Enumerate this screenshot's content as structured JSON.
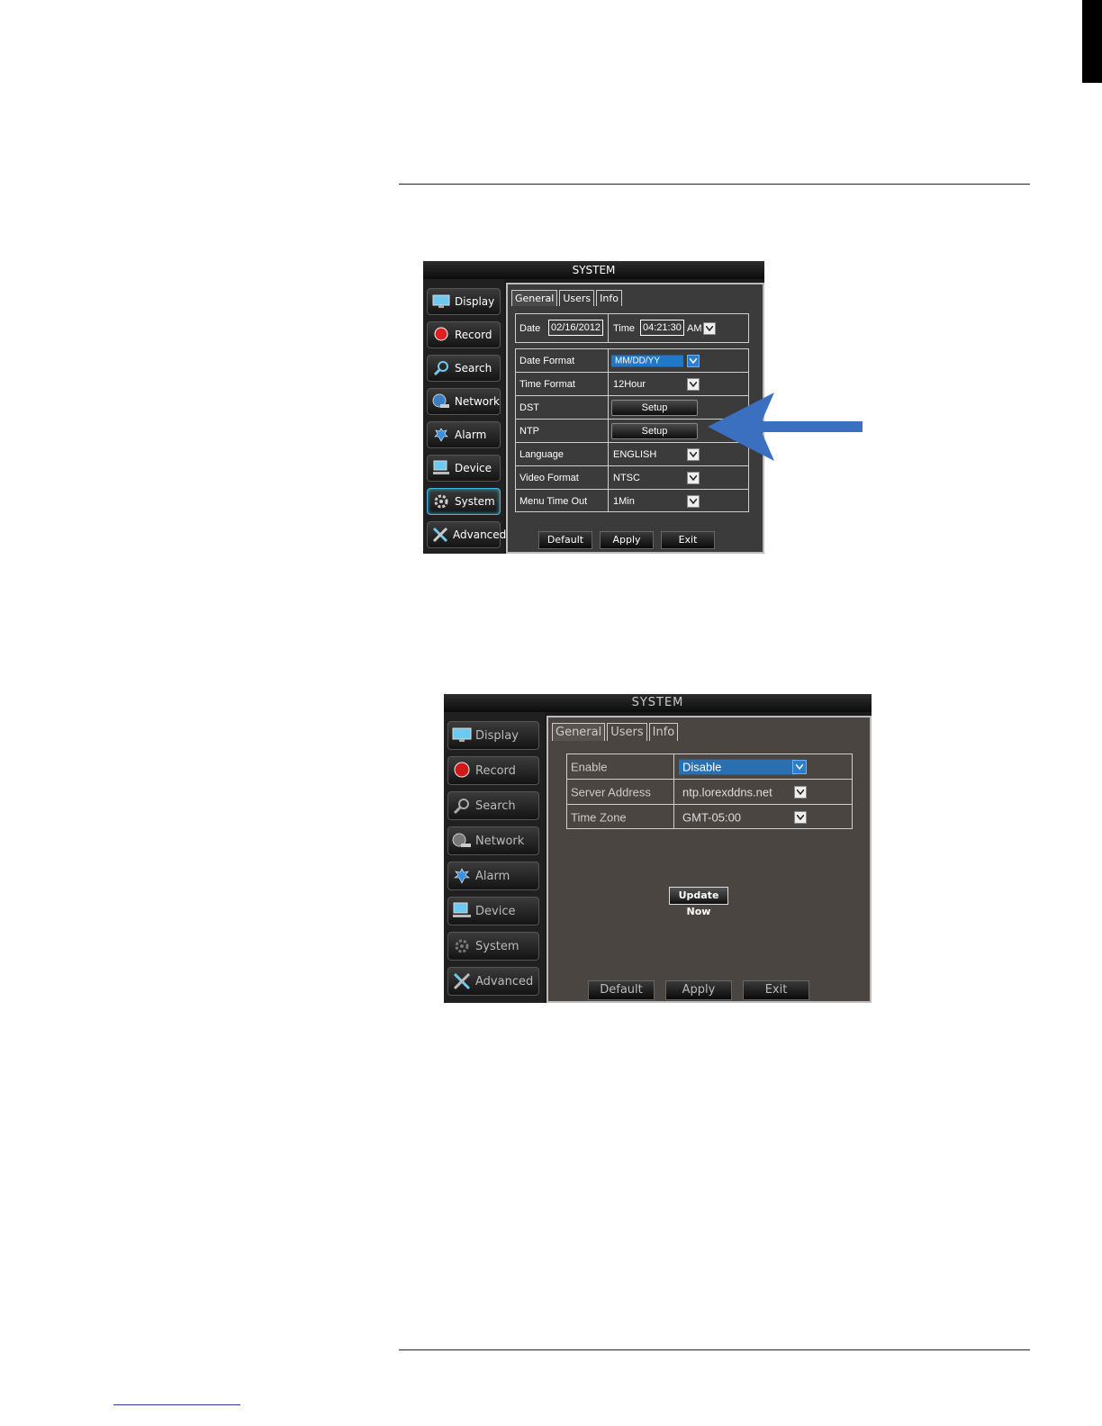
{
  "screenshot1": {
    "title": "SYSTEM",
    "sidebar": [
      "Display",
      "Record",
      "Search",
      "Network",
      "Alarm",
      "Device",
      "System",
      "Advanced"
    ],
    "tabs": [
      "General",
      "Users",
      "Info"
    ],
    "date_label": "Date",
    "date_value": "02/16/2012",
    "time_label": "Time",
    "time_value": "04:21:30",
    "ampm": "AM",
    "rows": [
      {
        "label": "Date Format",
        "value": "MM/DD/YY"
      },
      {
        "label": "Time Format",
        "value": "12Hour"
      },
      {
        "label": "DST",
        "value": "Setup"
      },
      {
        "label": "NTP",
        "value": "Setup"
      },
      {
        "label": "Language",
        "value": "ENGLISH"
      },
      {
        "label": "Video Format",
        "value": "NTSC"
      },
      {
        "label": "Menu Time Out",
        "value": "1Min"
      }
    ],
    "buttons": [
      "Default",
      "Apply",
      "Exit"
    ],
    "arrow_color": "#3b6fc0"
  },
  "screenshot2": {
    "title": "SYSTEM",
    "sidebar": [
      "Display",
      "Record",
      "Search",
      "Network",
      "Alarm",
      "Device",
      "System",
      "Advanced"
    ],
    "tabs": [
      "General",
      "Users",
      "Info"
    ],
    "rows": [
      {
        "label": "Enable",
        "value": "Disable"
      },
      {
        "label": "Server Address",
        "value": "ntp.lorexddns.net"
      },
      {
        "label": "Time Zone",
        "value": "GMT-05:00"
      }
    ],
    "update_button": "Update Now",
    "buttons": [
      "Default",
      "Apply",
      "Exit"
    ]
  }
}
